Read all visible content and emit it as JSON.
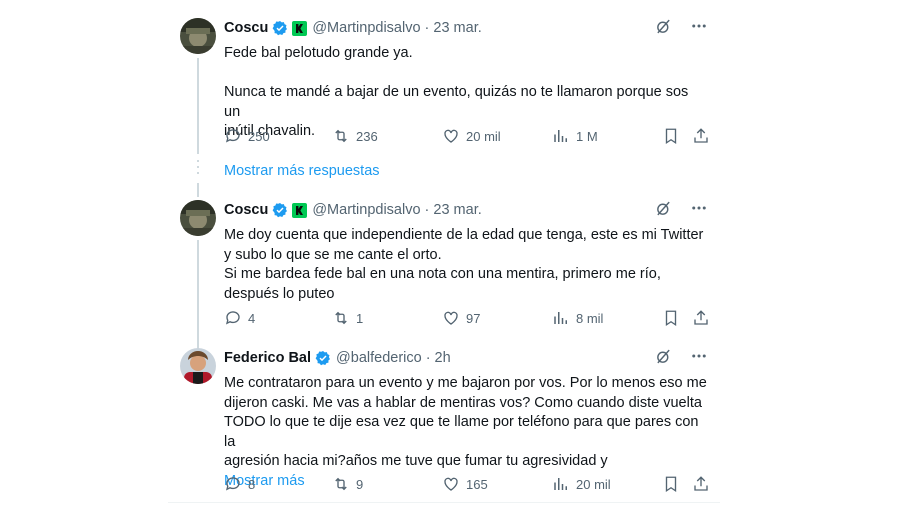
{
  "tweets": [
    {
      "name": "Coscu",
      "handle": "@Martinpdisalvo",
      "sep": "·",
      "time": "23 mar.",
      "lines": [
        "Fede bal pelotudo grande ya.",
        "",
        "Nunca te mandé a bajar de un evento, quizás no te llamaron porque sos un",
        "inútil chavalin."
      ],
      "stats": {
        "replies": "250",
        "retweets": "236",
        "likes": "20 mil",
        "views": "1 M"
      }
    },
    {
      "name": "Coscu",
      "handle": "@Martinpdisalvo",
      "sep": "·",
      "time": "23 mar.",
      "lines": [
        "Me doy cuenta que independiente de la edad que tenga, este es mi Twitter",
        "y subo lo que se me cante el orto.",
        "Si me bardea fede bal en una nota con una mentira, primero me río,",
        "después lo puteo"
      ],
      "stats": {
        "replies": "4",
        "retweets": "1",
        "likes": "97",
        "views": "8 mil"
      }
    },
    {
      "name": "Federico Bal",
      "handle": "@balfederico",
      "sep": "·",
      "time": "2h",
      "lines": [
        "Me contrataron para un evento y me bajaron por vos. Por lo menos eso me",
        "dijeron caski. Me vas a hablar de mentiras vos? Como cuando diste vuelta",
        "TODO lo que te dije esa vez que te llame por teléfono para que pares con la",
        "agresión hacia mi?años me tuve que fumar tu agresividad y"
      ],
      "show_more": "Mostrar más",
      "stats": {
        "replies": "8",
        "retweets": "9",
        "likes": "165",
        "views": "20 mil"
      }
    }
  ],
  "more_replies_label": "Mostrar más respuestas",
  "colors": {
    "accent": "#1d9bf0",
    "text": "#0f1419",
    "secondary": "#536471",
    "badge": "#00c853"
  },
  "icons": [
    "verified-icon",
    "kick-badge-icon",
    "grok-icon",
    "more-icon",
    "reply-icon",
    "retweet-icon",
    "like-icon",
    "views-icon",
    "bookmark-icon",
    "share-icon"
  ]
}
